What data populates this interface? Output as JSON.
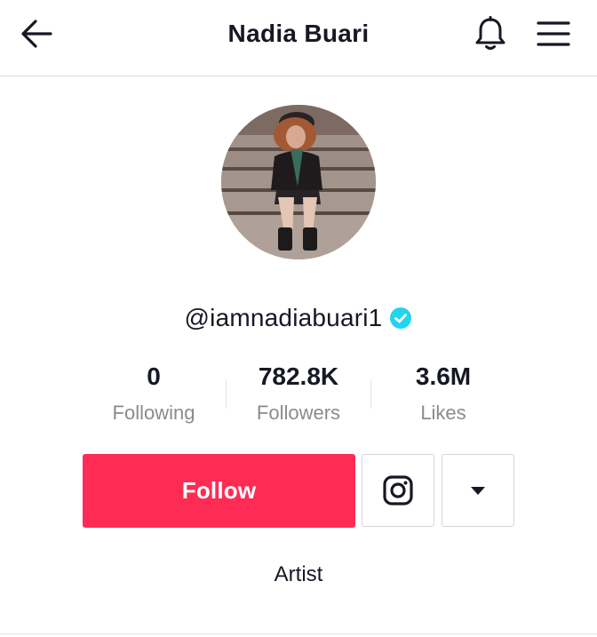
{
  "header": {
    "title": "Nadia Buari",
    "back_icon": "arrow-left-icon",
    "notification_icon": "bell-icon",
    "menu_icon": "hamburger-menu-icon"
  },
  "profile": {
    "username": "@iamnadiabuari1",
    "verified": true,
    "verified_color": "#20d5ec",
    "bio": "Artist"
  },
  "stats": [
    {
      "value": "0",
      "label": "Following"
    },
    {
      "value": "782.8K",
      "label": "Followers"
    },
    {
      "value": "3.6M",
      "label": "Likes"
    }
  ],
  "actions": {
    "follow_label": "Follow",
    "follow_color": "#fe2c55",
    "instagram_icon": "instagram-icon",
    "more_icon": "caret-down-icon"
  }
}
